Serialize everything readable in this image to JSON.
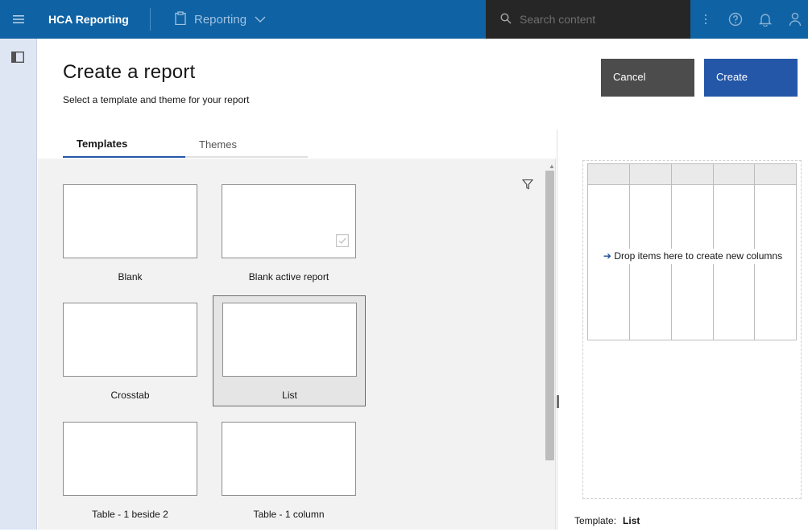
{
  "topbar": {
    "app_title": "HCA Reporting",
    "module_label": "Reporting",
    "search_placeholder": "Search content"
  },
  "header": {
    "title": "Create a report",
    "subtitle": "Select a template and theme for your report",
    "cancel_label": "Cancel",
    "create_label": "Create"
  },
  "tabs": [
    {
      "label": "Templates",
      "active": true
    },
    {
      "label": "Themes",
      "active": false
    }
  ],
  "templates": [
    {
      "label": "Blank"
    },
    {
      "label": "Blank active report"
    },
    {
      "label": "Crosstab"
    },
    {
      "label": "List",
      "selected": true
    },
    {
      "label": "Table - 1 beside 2"
    },
    {
      "label": "Table - 1 column"
    }
  ],
  "preview": {
    "drop_message": "Drop items here to create new columns",
    "template_caption": "Template:",
    "template_value": "List"
  },
  "colors": {
    "topbar": "#0f62a3",
    "search": "#262626",
    "primary_button": "#2457a8",
    "secondary_button": "#4c4c4c"
  }
}
